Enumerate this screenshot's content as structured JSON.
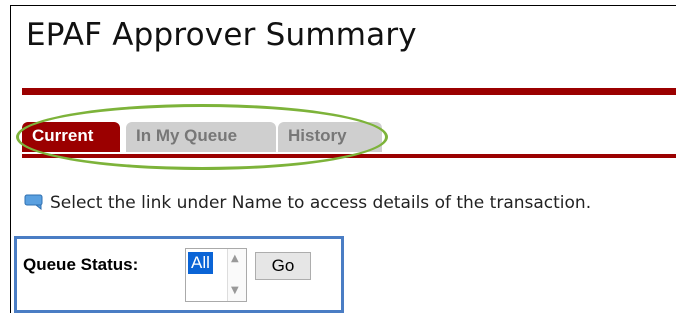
{
  "page": {
    "title": "EPAF Approver Summary"
  },
  "tabs": [
    {
      "label": "Current",
      "active": true
    },
    {
      "label": "In My Queue",
      "active": false
    },
    {
      "label": "History",
      "active": false
    }
  ],
  "info": {
    "icon": "info-speech-icon",
    "text": "Select the link under Name to access details of the transaction."
  },
  "queue": {
    "label": "Queue Status:",
    "selected": "All",
    "go_label": "Go"
  },
  "colors": {
    "brand_red": "#9b0000",
    "highlight_green": "#7db33a",
    "highlight_blue": "#4a7dc4",
    "selection_blue": "#0a64d6"
  }
}
